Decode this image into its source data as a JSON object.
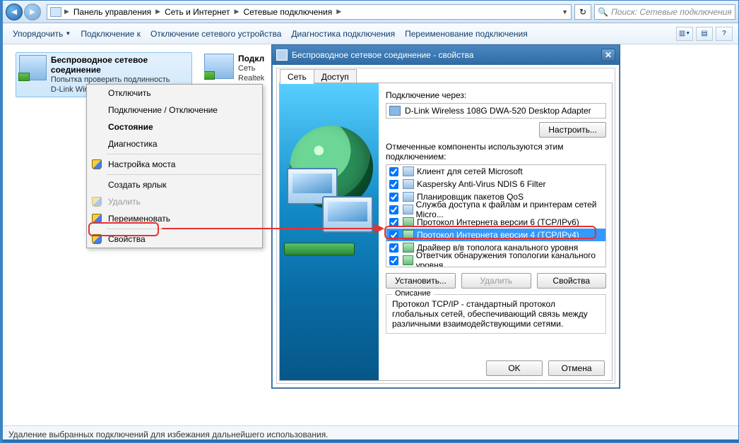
{
  "breadcrumbs": {
    "b1": "Панель управления",
    "b2": "Сеть и Интернет",
    "b3": "Сетевые подключения"
  },
  "search_placeholder": "Поиск: Сетевые подключения",
  "toolbar": {
    "organize": "Упорядочить",
    "connect": "Подключение к",
    "disable": "Отключение сетевого устройства",
    "diag": "Диагностика подключения",
    "rename": "Переименование подключения"
  },
  "conn1": {
    "title": "Беспроводное сетевое соединение",
    "l2": "Попытка проверить подлинность",
    "l3": "D-Link Wireless 108G DWA-520 De..."
  },
  "conn2": {
    "title": "Подкл",
    "l2": "Сеть",
    "l3": "Realtek"
  },
  "ctx": {
    "disable": "Отключить",
    "connect": "Подключение / Отключение",
    "status": "Состояние",
    "diag": "Диагностика",
    "bridge": "Настройка моста",
    "shortcut": "Создать ярлык",
    "delete": "Удалить",
    "rename": "Переименовать",
    "props": "Свойства"
  },
  "dlg": {
    "title": "Беспроводное сетевое соединение - свойства",
    "tab_net": "Сеть",
    "tab_access": "Доступ",
    "via": "Подключение через:",
    "adapter": "D-Link Wireless 108G DWA-520 Desktop Adapter",
    "configure": "Настроить...",
    "components_lbl": "Отмеченные компоненты используются этим подключением:",
    "components": [
      "Клиент для сетей Microsoft",
      "Kaspersky Anti-Virus NDIS 6 Filter",
      "Планировщик пакетов QoS",
      "Служба доступа к файлам и принтерам сетей Micro...",
      "Протокол Интернета версии 6 (TCP/IPv6)",
      "Протокол Интернета версии 4 (TCP/IPv4)",
      "Драйвер в/в тополога канального уровня",
      "Ответчик обнаружения топологии канального уровня"
    ],
    "install": "Установить...",
    "remove": "Удалить",
    "properties": "Свойства",
    "desc_legend": "Описание",
    "desc_text": "Протокол TCP/IP - стандартный протокол глобальных сетей, обеспечивающий связь между различными взаимодействующими сетями.",
    "ok": "OK",
    "cancel": "Отмена"
  },
  "statusbar": "Удаление выбранных подключений для избежания дальнейшего использования."
}
